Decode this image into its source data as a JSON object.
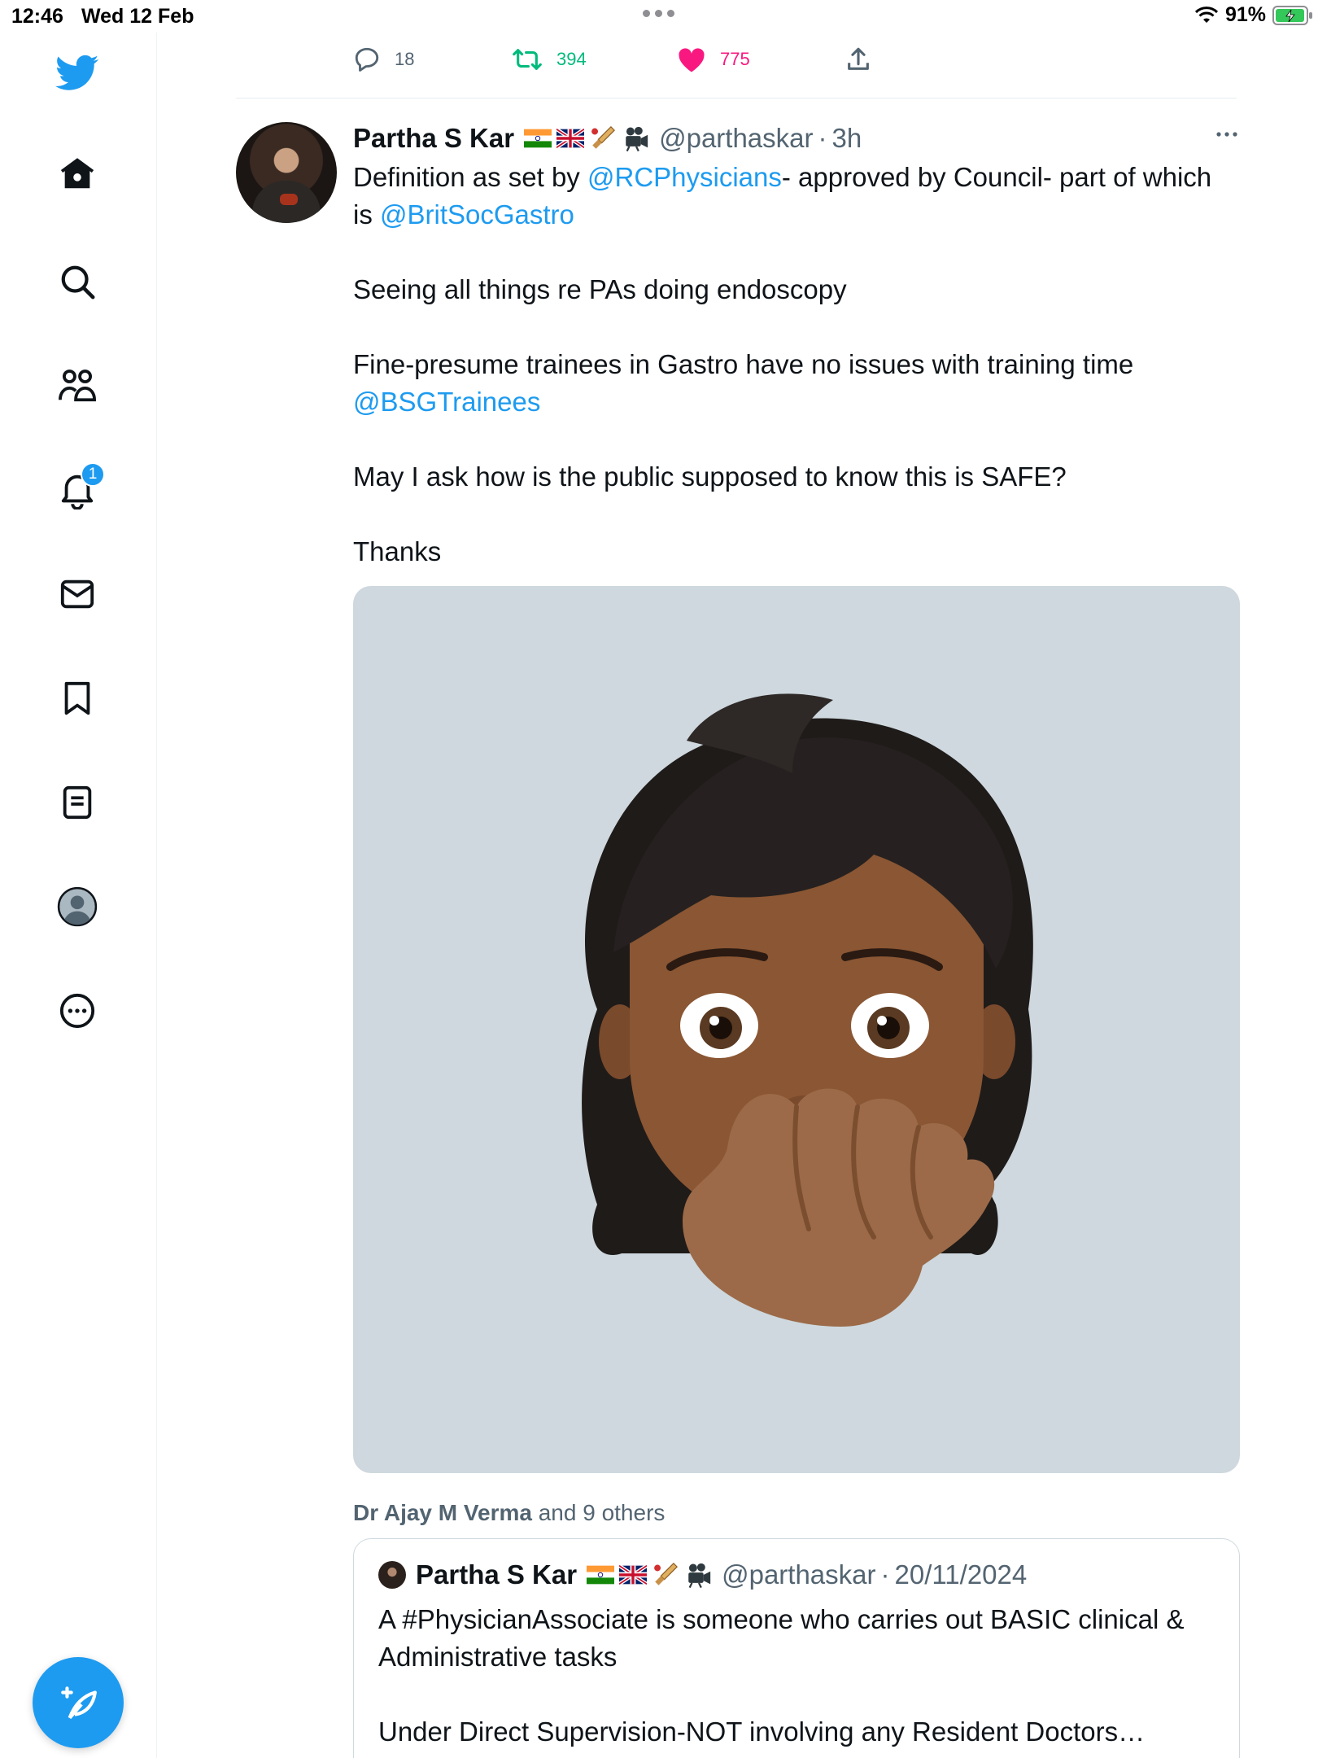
{
  "status_bar": {
    "time": "12:46",
    "date": "Wed 12 Feb",
    "battery": "91%"
  },
  "sidebar": {
    "notifications_badge": "1",
    "items": [
      "Home",
      "Explore",
      "Communities",
      "Notifications",
      "Messages",
      "Bookmarks",
      "Lists",
      "Profile",
      "More"
    ]
  },
  "prev_tweet_actions": {
    "replies": "18",
    "retweets": "394",
    "likes": "775"
  },
  "tweet": {
    "name": "Partha S Kar",
    "handle": "@parthaskar",
    "sep": "·",
    "time": "3h",
    "line1_pre": "Definition as set by ",
    "line1_link": "@RCPhysicians",
    "line1_post": "- approved by Council- part of which",
    "line2_pre": "is ",
    "line2_link": "@BritSocGastro",
    "para2": "Seeing all things re PAs doing endoscopy",
    "para3": "Fine-presume trainees in Gastro have no issues with training time",
    "para3_link": "@BSGTrainees",
    "para4": "May I ask how is the public supposed to know this is SAFE?",
    "para5": "Thanks",
    "liked_by_name": "Dr Ajay M Verma",
    "liked_by_rest": " and 9 others"
  },
  "quote": {
    "name": "Partha S Kar",
    "handle": "@parthaskar",
    "sep": "·",
    "date": "20/11/2024",
    "line1": "A #PhysicianAssociate is someone who carries out BASIC clinical &",
    "line2": "Administrative tasks",
    "line3": "Under Direct Supervision-NOT involving any Resident Doctors…"
  },
  "colors": {
    "accent": "#1d9bf0",
    "retweet": "#00ba7c",
    "like": "#f91880",
    "secondary": "#536471"
  }
}
